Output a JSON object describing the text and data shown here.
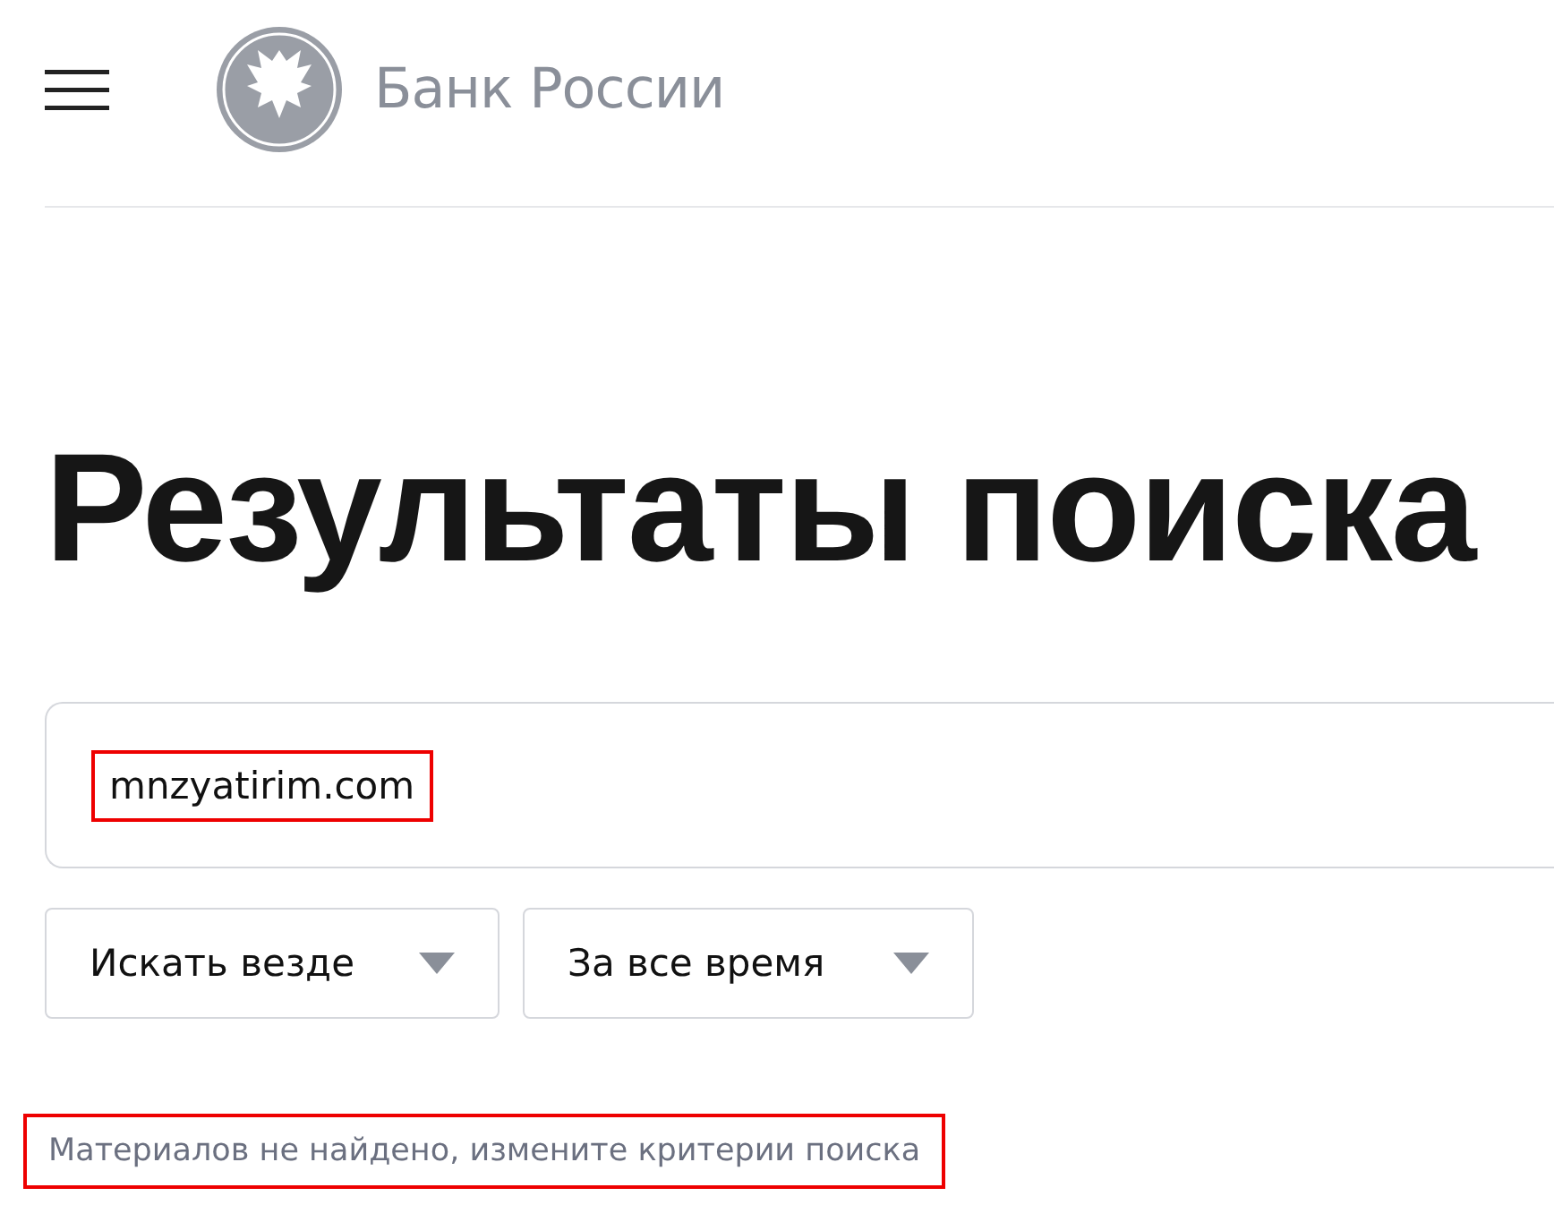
{
  "header": {
    "brand": "Банк России"
  },
  "heading": "Результаты поиска",
  "search": {
    "value": "mnzyatirim.com",
    "highlighted": true
  },
  "filters": [
    {
      "label": "Искать везде"
    },
    {
      "label": "За все время"
    }
  ],
  "message": {
    "text": "Материалов не найдено, измените критерии поиска",
    "highlighted": true
  }
}
